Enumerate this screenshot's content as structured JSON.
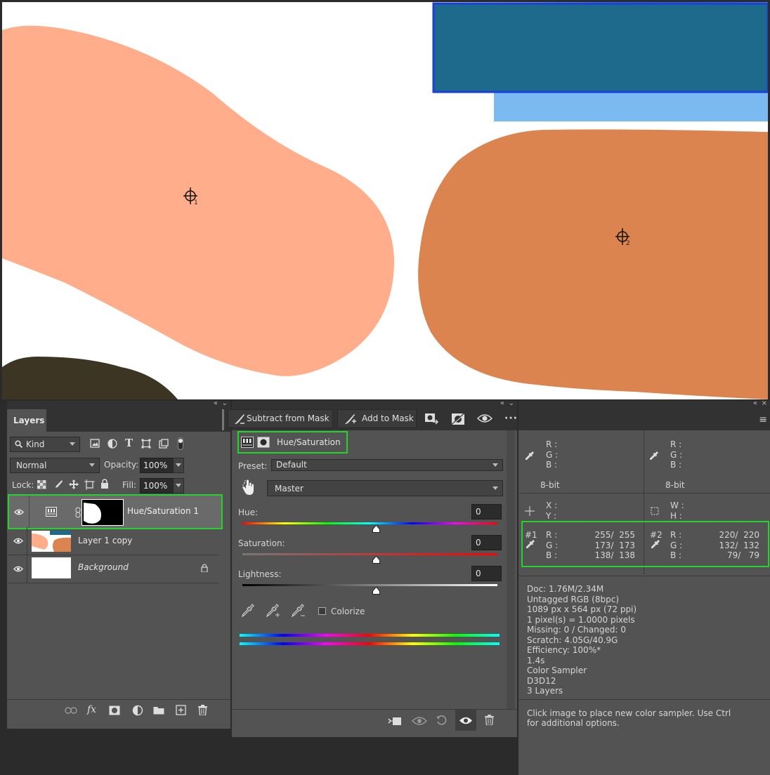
{
  "layers_panel": {
    "tab_label": "Layers",
    "filter_kind": "Kind",
    "blend_mode": "Normal",
    "opacity_label": "Opacity:",
    "opacity_value": "100%",
    "lock_label": "Lock:",
    "fill_label": "Fill:",
    "fill_value": "100%",
    "layers": [
      {
        "name": "Hue/Saturation 1",
        "selected": true
      },
      {
        "name": "Layer 1 copy",
        "selected": false
      },
      {
        "name": "Background",
        "selected": false,
        "locked": true
      }
    ]
  },
  "properties_panel": {
    "subtract_mask_label": "Subtract from Mask",
    "add_mask_label": "Add to Mask",
    "adjustment_title": "Hue/Saturation",
    "preset_label": "Preset:",
    "preset_value": "Default",
    "channel_value": "Master",
    "hue_label": "Hue:",
    "hue_value": "0",
    "saturation_label": "Saturation:",
    "saturation_value": "0",
    "lightness_label": "Lightness:",
    "lightness_value": "0",
    "colorize_label": "Colorize",
    "colorize_checked": false
  },
  "info_panel": {
    "r_label": "R :",
    "g_label": "G :",
    "b_label": "B :",
    "bit_left": "8-bit",
    "bit_right": "8-bit",
    "x_label": "X :",
    "y_label": "Y :",
    "w_label": "W :",
    "h_label": "H :",
    "sampler1": {
      "id": "#1",
      "r": "255/  255",
      "g": "173/  173",
      "b": "138/  138"
    },
    "sampler2": {
      "id": "#2",
      "r": "220/  220",
      "g": "132/  132",
      "b": "79/   79"
    },
    "doc_info": [
      "Doc: 1.76M/2.34M",
      "Untagged RGB (8bpc)",
      "1089 px x 564 px (72 ppi)",
      "1 pixel(s) = 1.0000 pixels",
      "Missing: 0 / Changed: 0",
      "Scratch: 4.05G/40.9G",
      "Efficiency: 100%*",
      "1.4s",
      "Color Sampler",
      "D3D12",
      "3 Layers"
    ],
    "hint": "Click image to place new color sampler.  Use Ctrl for additional options."
  },
  "canvas": {
    "sampler1_number": "1",
    "sampler2_number": "2",
    "colors": {
      "light_orange": "#FFAD8A",
      "dark_orange": "#DC844F",
      "blue": "#1D6A8D"
    }
  }
}
